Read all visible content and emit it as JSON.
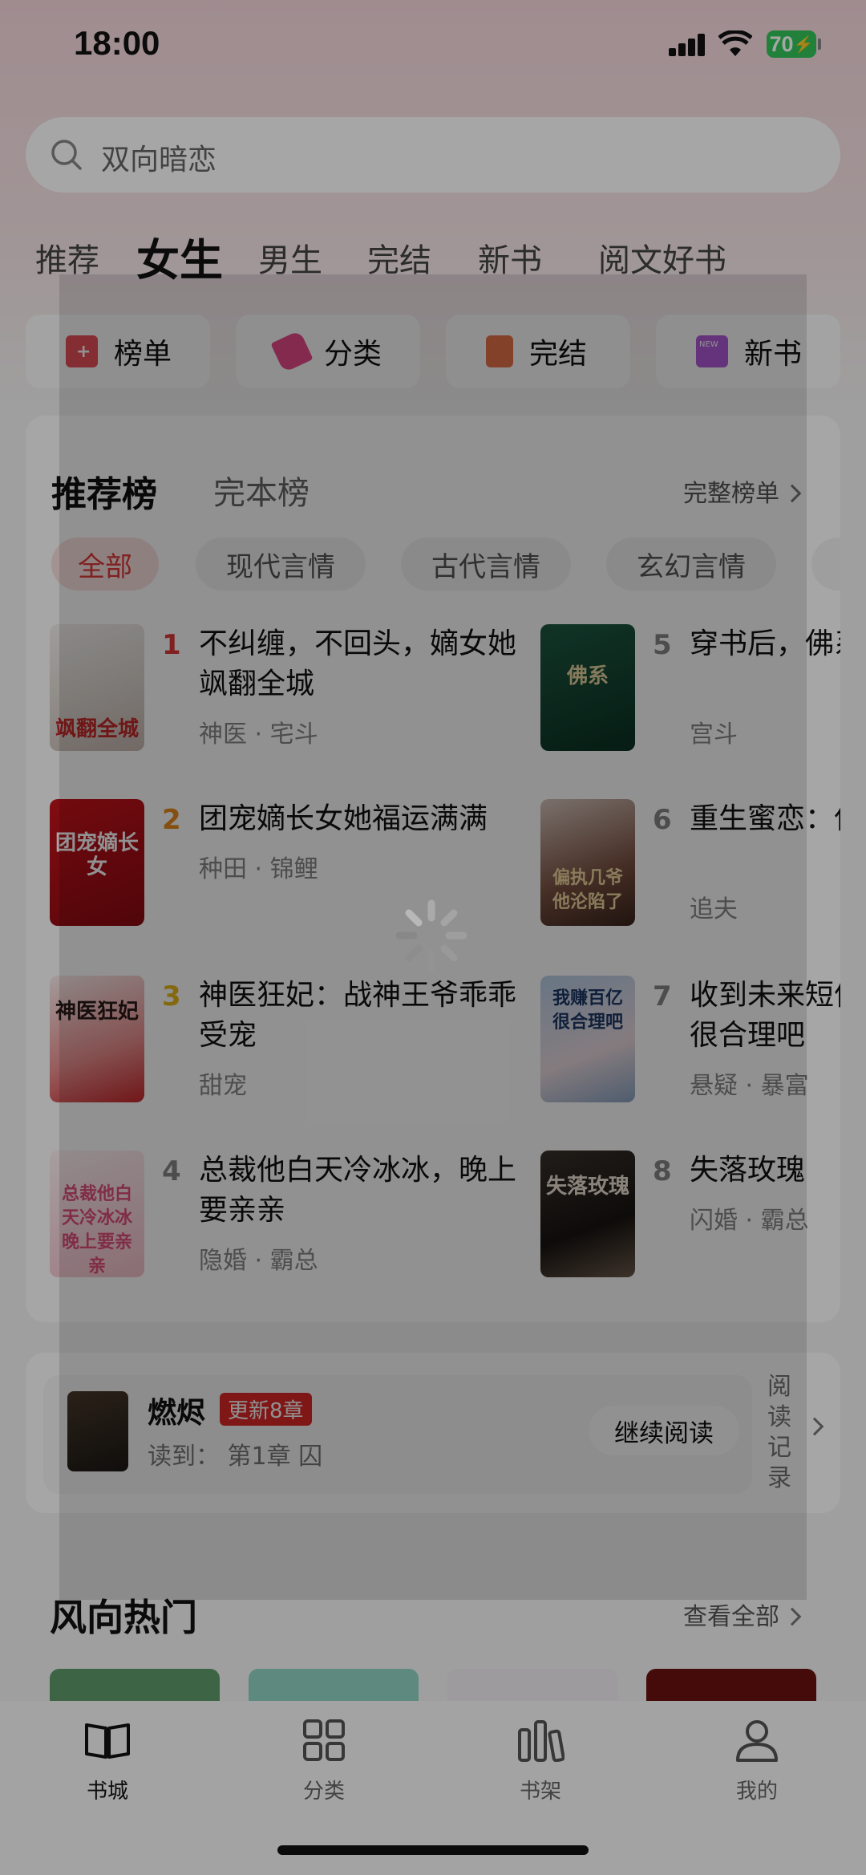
{
  "status_bar": {
    "time": "18:00",
    "battery": "70"
  },
  "search": {
    "placeholder": "双向暗恋"
  },
  "tabs": [
    "推荐",
    "女生",
    "男生",
    "完结",
    "新书",
    "阅文好书"
  ],
  "active_tab": "女生",
  "quick_entries": [
    {
      "label": "榜单",
      "icon": "ranking-icon",
      "color": "#e8505b"
    },
    {
      "label": "分类",
      "icon": "tags-icon",
      "color": "#ea4b8b"
    },
    {
      "label": "完结",
      "icon": "book-done-icon",
      "color": "#e9734a"
    },
    {
      "label": "新书",
      "icon": "new-book-icon",
      "color": "#b35bd8"
    }
  ],
  "ranking": {
    "tab_recommend": "推荐榜",
    "tab_complete": "完本榜",
    "more": "完整榜单",
    "chips": [
      "全部",
      "现代言情",
      "古代言情",
      "玄幻言情"
    ],
    "books": [
      {
        "rank": "1",
        "title": "不纠缠，不回头，嫡女她飒翻全城",
        "tags": "神医 · 宅斗",
        "cover_text": "飒翻全城"
      },
      {
        "rank": "2",
        "title": "团宠嫡长女她福运满满",
        "tags": "种田 · 锦鲤",
        "cover_text": "团宠嫡长女"
      },
      {
        "rank": "3",
        "title": "神医狂妃：战神王爷乖乖受宠",
        "tags": "甜宠",
        "cover_text": "神医狂妃"
      },
      {
        "rank": "4",
        "title": "总裁他白天冷冰冰，晚上要亲亲",
        "tags": "隐婚 · 霸总",
        "cover_text": "总裁他白天冷冰冰 晚上要亲亲"
      },
      {
        "rank": "5",
        "title": "穿书后，佛系透了",
        "tags": "宫斗",
        "cover_text": "佛系"
      },
      {
        "rank": "6",
        "title": "重生蜜恋：偏执他沦陷了",
        "tags": "追夫",
        "cover_text": "偏执几爷 他沦陷了"
      },
      {
        "rank": "7",
        "title": "收到未来短信，我赚百亿很合理吧",
        "tags": "悬疑 · 暴富",
        "cover_text": "我赚百亿 很合理吧"
      },
      {
        "rank": "8",
        "title": "失落玫瑰",
        "tags": "闪婚 · 霸总",
        "cover_text": "失落玫瑰"
      }
    ]
  },
  "recent": {
    "title": "燃烬",
    "badge": "更新8章",
    "progress": "读到：  第1章 囚",
    "continue": "继续阅读",
    "history": [
      "阅",
      "读",
      "记",
      "录"
    ]
  },
  "hot": {
    "title": "风向热门",
    "more": "查看全部"
  },
  "bottom_nav": [
    {
      "label": "书城",
      "icon": "book-open-icon"
    },
    {
      "label": "分类",
      "icon": "grid-icon"
    },
    {
      "label": "书架",
      "icon": "shelf-icon"
    },
    {
      "label": "我的",
      "icon": "user-icon"
    }
  ],
  "colors": {
    "accent": "#e03a3a",
    "rank1": "#e03a3a",
    "rank2": "#e88a1c",
    "rank3": "#e8b81c"
  }
}
